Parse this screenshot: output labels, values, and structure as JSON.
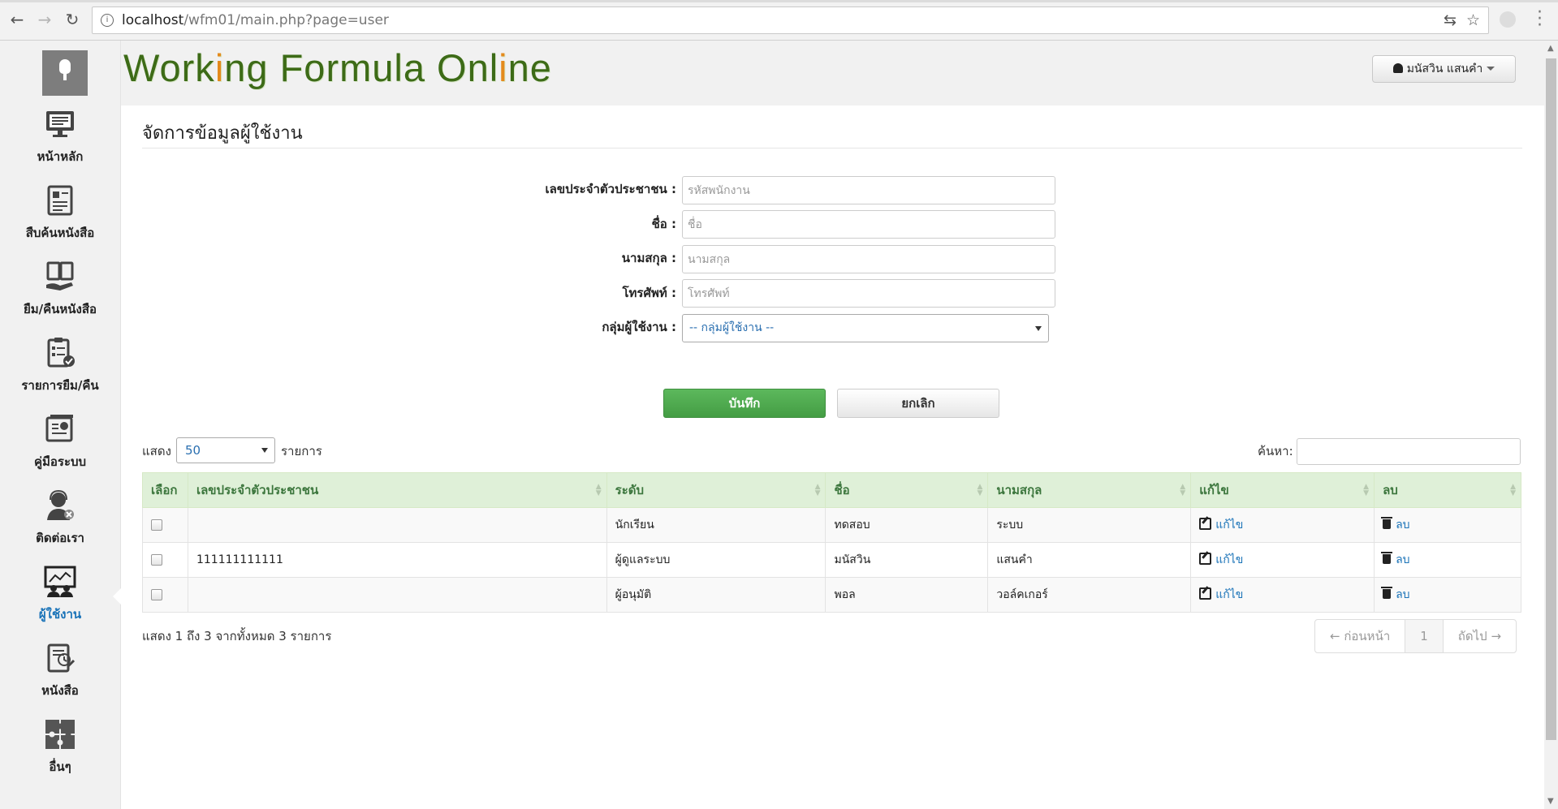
{
  "browser": {
    "url_host": "localhost",
    "url_path": "/wfm01/main.php?page=user"
  },
  "header": {
    "logo_parts": [
      "W",
      "ork",
      "i",
      "ng Formula Onl",
      "i",
      "ne"
    ],
    "user_name": "มนัสวิน แสนคำ"
  },
  "sidebar": {
    "items": [
      {
        "label": "หน้าหลัก",
        "icon": "monitor-icon"
      },
      {
        "label": "สืบค้นหนังสือ",
        "icon": "document-search-icon"
      },
      {
        "label": "ยืม/คืนหนังสือ",
        "icon": "books-hand-icon"
      },
      {
        "label": "รายการยืม/คืน",
        "icon": "checklist-icon"
      },
      {
        "label": "คู่มือระบบ",
        "icon": "manual-icon"
      },
      {
        "label": "ติดต่อเรา",
        "icon": "support-agent-icon"
      },
      {
        "label": "ผู้ใช้งาน",
        "icon": "users-board-icon",
        "active": true
      },
      {
        "label": "หนังสือ",
        "icon": "book-edit-icon"
      },
      {
        "label": "อื่นๆ",
        "icon": "puzzle-icon"
      }
    ]
  },
  "page": {
    "title": "จัดการข้อมูลผู้ใช้งาน"
  },
  "form": {
    "id_label": "เลขประจำตัวประชาชน :",
    "id_placeholder": "รหัสพนักงาน",
    "name_label": "ชื่อ :",
    "name_placeholder": "ชื่อ",
    "surname_label": "นามสกุล :",
    "surname_placeholder": "นามสกุล",
    "phone_label": "โทรศัพท์ :",
    "phone_placeholder": "โทรศัพท์",
    "group_label": "กลุ่มผู้ใช้งาน :",
    "group_value": "-- กลุ่มผู้ใช้งาน --",
    "save_label": "บันทึก",
    "cancel_label": "ยกเลิก"
  },
  "table_controls": {
    "show_label": "แสดง",
    "page_length": "50",
    "entries_label": "รายการ",
    "search_label": "ค้นหา:"
  },
  "table": {
    "columns": [
      "เลือก",
      "เลขประจำตัวประชาชน",
      "ระดับ",
      "ชื่อ",
      "นามสกุล",
      "แก้ไข",
      "ลบ"
    ],
    "edit_label": "แก้ไข",
    "delete_label": "ลบ",
    "rows": [
      {
        "id": "",
        "level": "นักเรียน",
        "first": "ทดสอบ",
        "last": "ระบบ"
      },
      {
        "id": "111111111111",
        "level": "ผู้ดูแลระบบ",
        "first": "มนัสวิน",
        "last": "แสนคำ"
      },
      {
        "id": "",
        "level": "ผู้อนุมัติ",
        "first": "พอล",
        "last": "วอล์คเกอร์"
      }
    ]
  },
  "footer": {
    "info": "แสดง 1 ถึง 3 จากทั้งหมด 3 รายการ",
    "prev": "← ก่อนหน้า",
    "page": "1",
    "next": "ถัดไป →"
  }
}
